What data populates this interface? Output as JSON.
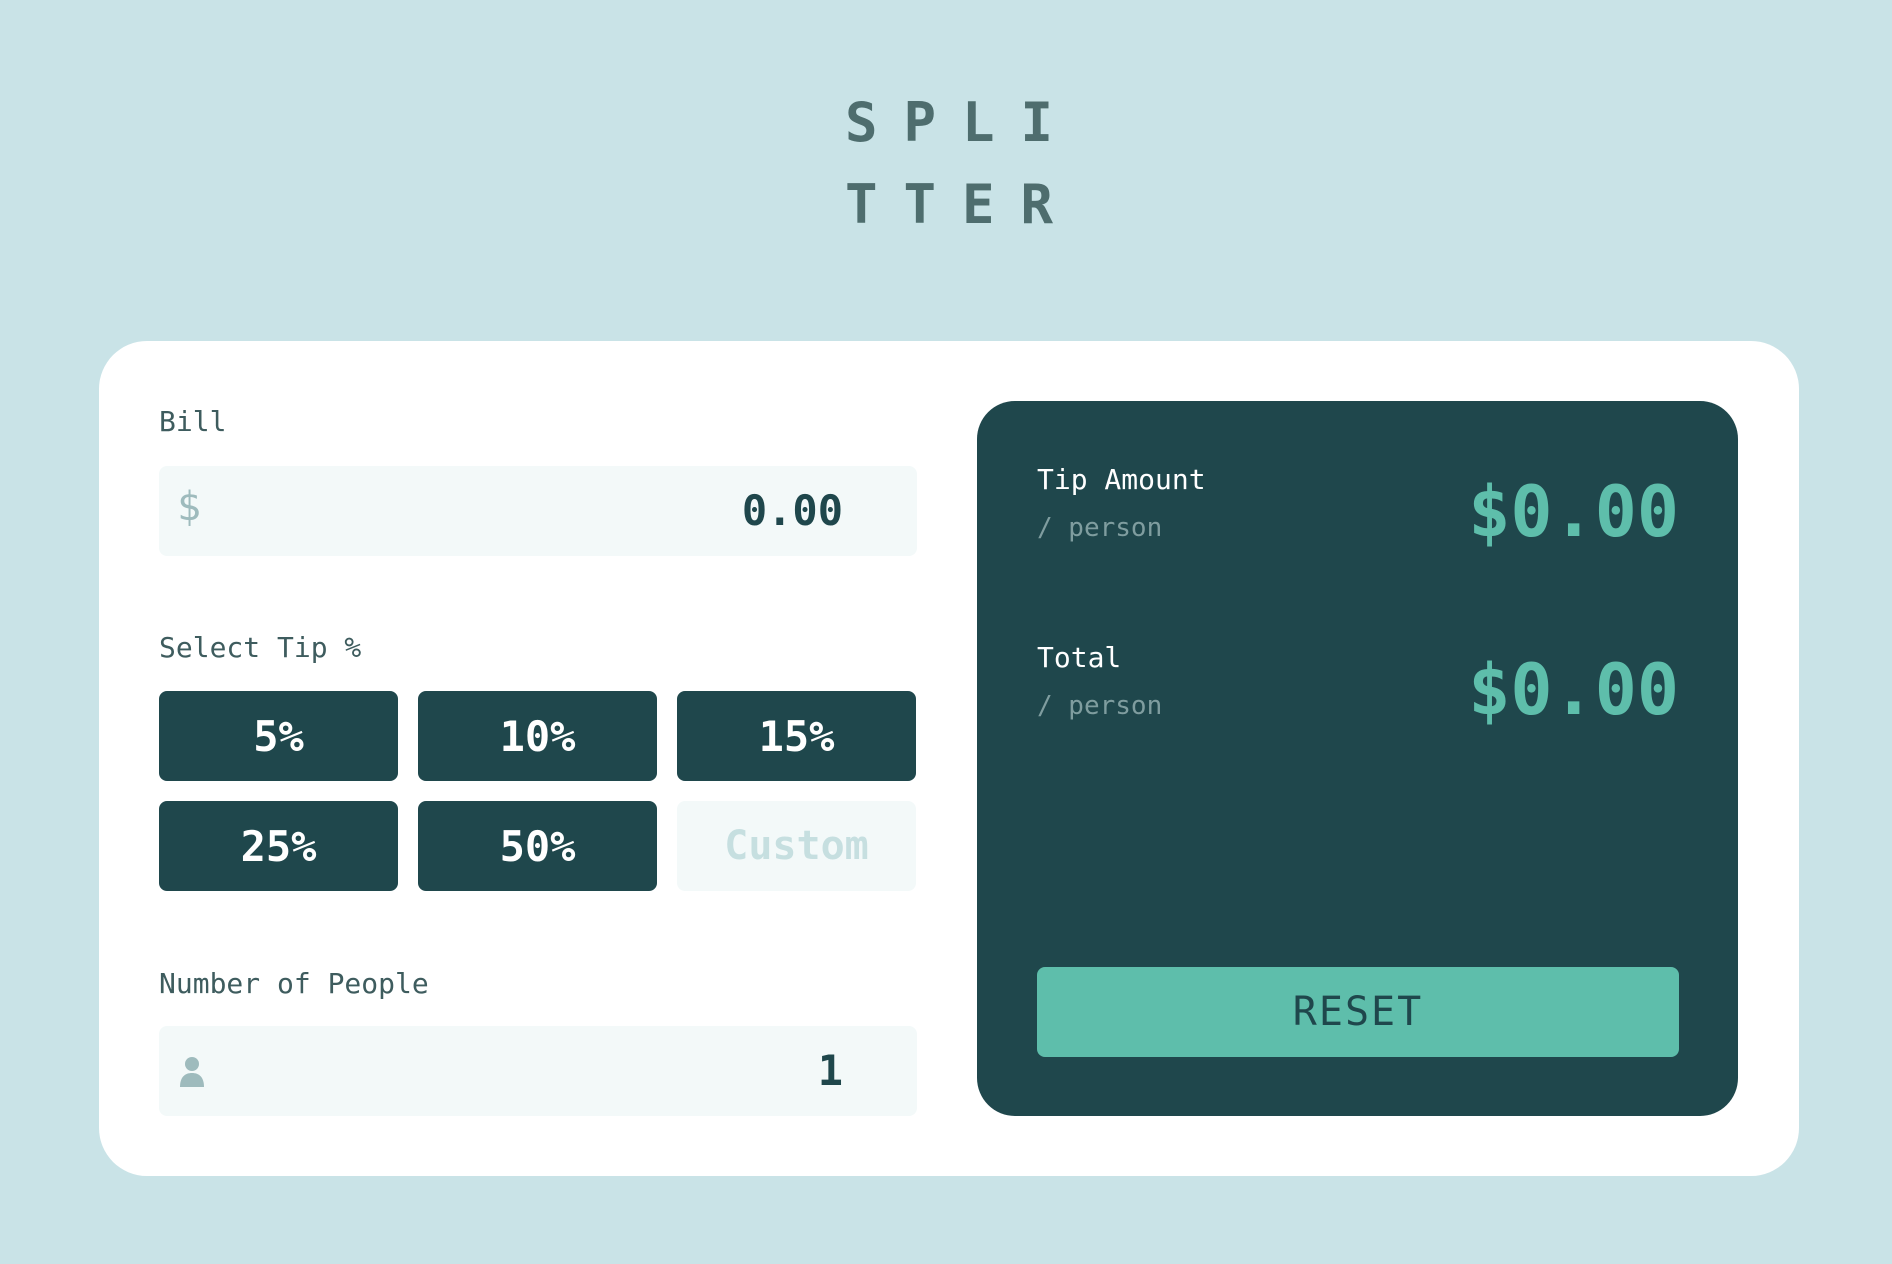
{
  "header": {
    "logo_line1": "SPLI",
    "logo_line2": "TTER"
  },
  "bill": {
    "label": "Bill",
    "currency_icon": "$",
    "value": "0.00"
  },
  "tip": {
    "label": "Select Tip %",
    "options": [
      "5%",
      "10%",
      "15%",
      "25%",
      "50%"
    ],
    "custom_placeholder": "Custom"
  },
  "people": {
    "label": "Number of People",
    "icon": "person-icon",
    "value": "1"
  },
  "results": {
    "tip_amount": {
      "title": "Tip Amount",
      "sub": "/ person",
      "value": "$0.00"
    },
    "total": {
      "title": "Total",
      "sub": "/ person",
      "value": "$0.00"
    },
    "reset_label": "RESET"
  },
  "colors": {
    "background": "#c9e3e7",
    "dark_teal": "#1f474c",
    "accent": "#5ebeab",
    "input_bg": "#f3f9f9"
  }
}
